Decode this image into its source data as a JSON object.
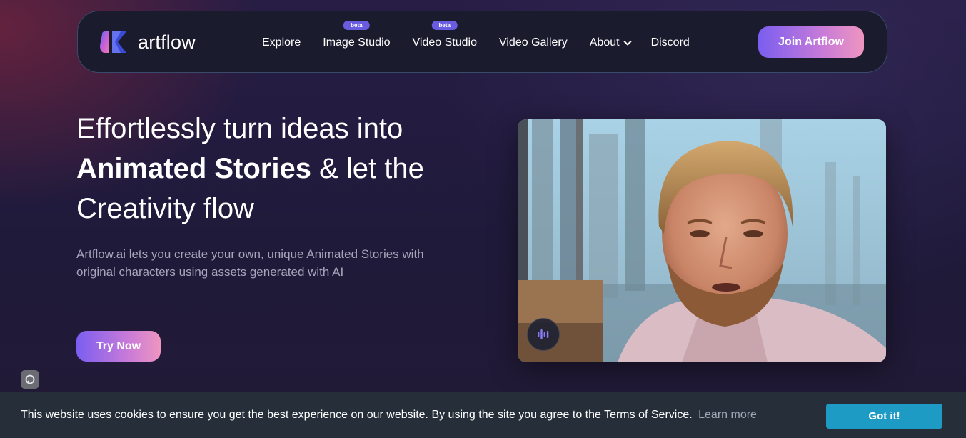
{
  "brand": {
    "logo_text": "artflow",
    "logo_icon": "artflow-logo-icon"
  },
  "nav": {
    "items": [
      {
        "label": "Explore",
        "badge": ""
      },
      {
        "label": "Image Studio",
        "badge": "beta"
      },
      {
        "label": "Video Studio",
        "badge": "beta"
      },
      {
        "label": "Video Gallery",
        "badge": ""
      },
      {
        "label": "About",
        "badge": ""
      },
      {
        "label": "Discord",
        "badge": ""
      }
    ],
    "join_label": "Join Artflow"
  },
  "hero": {
    "headline_line1": "Effortlessly turn ideas into",
    "headline_bold": "Animated Stories",
    "headline_rest": " & let the",
    "headline_line3": "Creativity flow",
    "subtext": "Artflow.ai lets you create your own, unique Animated Stories with original characters using assets generated with AI",
    "cta_label": "Try Now"
  },
  "video": {
    "audio_icon": "audio-wave-icon"
  },
  "cookie": {
    "message": "This website uses cookies to ensure you get the best experience on our website. By using the site you agree to the Terms of Service.",
    "learn_more": "Learn more",
    "accept_label": "Got it!"
  },
  "colors": {
    "accent_start": "#7a5ef0",
    "accent_end": "#ee95c0",
    "badge": "#6a5ce0",
    "cookie_bg": "#252e39",
    "cookie_button": "#1e9bc4"
  }
}
